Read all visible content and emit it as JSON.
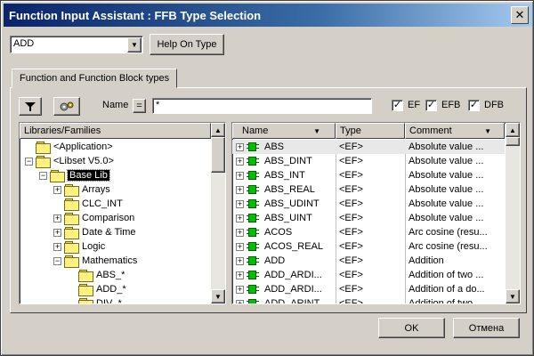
{
  "window": {
    "title": "Function Input Assistant : FFB Type Selection",
    "close_glyph": "✕"
  },
  "type_combo": {
    "value": "ADD",
    "arrow_glyph": "▼"
  },
  "help_button": "Help On Type",
  "tab_label": "Function and Function Block types",
  "toolbar": {
    "name_label": "Name",
    "equals_label": "=",
    "name_filter_value": "*",
    "ef_label": "EF",
    "efb_label": "EFB",
    "dfb_label": "DFB",
    "ef_checked": true,
    "efb_checked": true,
    "dfb_checked": true,
    "check_glyph": "✓"
  },
  "tree": {
    "header": "Libraries/Families",
    "items": [
      {
        "label": "<Application>",
        "expander": "",
        "level": 0
      },
      {
        "label": "<Libset V5.0>",
        "expander": "−",
        "level": 0
      },
      {
        "label": "Base Lib",
        "expander": "−",
        "level": 1,
        "selected": true
      },
      {
        "label": "Arrays",
        "expander": "+",
        "level": 2
      },
      {
        "label": "CLC_INT",
        "expander": "",
        "level": 2
      },
      {
        "label": "Comparison",
        "expander": "+",
        "level": 2
      },
      {
        "label": "Date & Time",
        "expander": "+",
        "level": 2
      },
      {
        "label": "Logic",
        "expander": "+",
        "level": 2
      },
      {
        "label": "Mathematics",
        "expander": "−",
        "level": 2
      },
      {
        "label": "ABS_*",
        "expander": "",
        "level": 3
      },
      {
        "label": "ADD_*",
        "expander": "",
        "level": 3
      },
      {
        "label": "DIV_*",
        "expander": "",
        "level": 3
      }
    ]
  },
  "grid": {
    "columns": [
      "Name",
      "Type",
      "Comment"
    ],
    "sort_glyph": "▼",
    "rows": [
      {
        "name": "ABS",
        "type": "<EF>",
        "comment": "Absolute value ..."
      },
      {
        "name": "ABS_DINT",
        "type": "<EF>",
        "comment": "Absolute value ..."
      },
      {
        "name": "ABS_INT",
        "type": "<EF>",
        "comment": "Absolute value ..."
      },
      {
        "name": "ABS_REAL",
        "type": "<EF>",
        "comment": "Absolute value ..."
      },
      {
        "name": "ABS_UDINT",
        "type": "<EF>",
        "comment": "Absolute value ..."
      },
      {
        "name": "ABS_UINT",
        "type": "<EF>",
        "comment": "Absolute value ..."
      },
      {
        "name": "ACOS",
        "type": "<EF>",
        "comment": "Arc cosine (resu..."
      },
      {
        "name": "ACOS_REAL",
        "type": "<EF>",
        "comment": "Arc cosine (resu..."
      },
      {
        "name": "ADD",
        "type": "<EF>",
        "comment": "Addition"
      },
      {
        "name": "ADD_ARDI...",
        "type": "<EF>",
        "comment": "Addition of two ..."
      },
      {
        "name": "ADD_ARDI...",
        "type": "<EF>",
        "comment": "Addition of a do..."
      },
      {
        "name": "ADD_ARINT",
        "type": "<EF>",
        "comment": "Addition of two ..."
      }
    ]
  },
  "footer": {
    "ok_label": "OK",
    "cancel_label": "Отмена"
  }
}
